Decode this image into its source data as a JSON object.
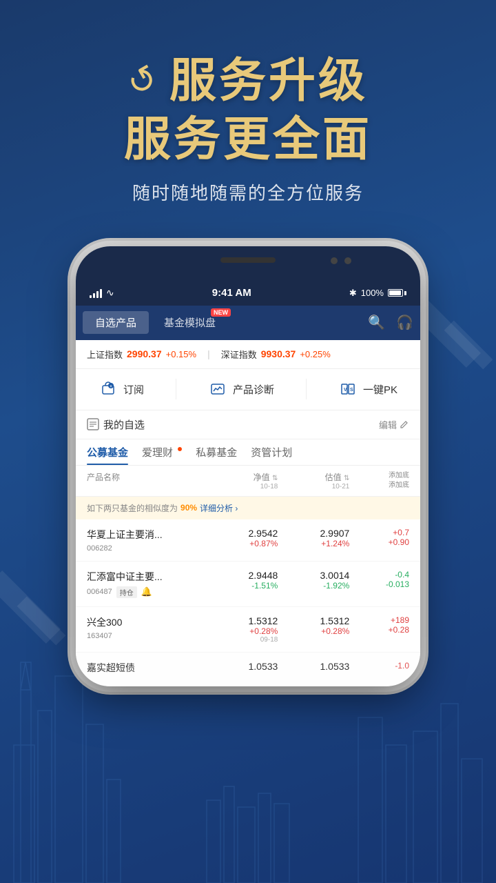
{
  "hero": {
    "title_line1": "服务升级",
    "title_line2": "服务更全面",
    "desc": "随时随地随需的全方位服务",
    "icon_unicode": "↺"
  },
  "phone": {
    "status_bar": {
      "signal": "|||",
      "wifi": "WiFi",
      "time": "9:41 AM",
      "bluetooth": "✱",
      "battery_pct": "100%"
    },
    "nav": {
      "tab1": "自选产品",
      "tab2": "基金模拟盘",
      "tab2_badge": "NEW"
    },
    "index_bar": {
      "sh_name": "上证指数",
      "sh_val": "2990.37",
      "sh_chg": "+0.15%",
      "sz_name": "深证指数",
      "sz_val": "9930.37",
      "sz_chg": "+0.25%"
    },
    "quick_actions": {
      "action1": "订阅",
      "action2": "产品诊断",
      "action3": "一键PK"
    },
    "watchlist": {
      "title": "我的自选",
      "edit": "编辑"
    },
    "fund_tabs": {
      "tab1": "公募基金",
      "tab2": "爱理财",
      "tab3": "私募基金",
      "tab4": "资管计划",
      "tab2_has_dot": true
    },
    "table_headers": {
      "name": "产品名称",
      "nav": "净值",
      "nav_date": "10-18",
      "est": "估值",
      "est_date": "10-21",
      "add": "添加底\n添加底"
    },
    "similarity_warning": {
      "text_before": "如下两只基金的相似度为",
      "pct": "90%",
      "link": "详细分析 ›"
    },
    "funds": [
      {
        "name": "华夏上证主要消...",
        "code": "006282",
        "tag": "",
        "has_bell": false,
        "nav": "2.9542",
        "nav_chg": "+0.87%",
        "nav_up": true,
        "est": "2.9907",
        "est_chg": "+1.24%",
        "est_up": true,
        "action": "+0.7\n+0.90"
      },
      {
        "name": "汇添富中证主要...",
        "code": "006487",
        "tag": "持仓",
        "has_bell": true,
        "nav": "2.9448",
        "nav_chg": "-1.51%",
        "nav_up": false,
        "est": "3.0014",
        "est_chg": "-1.92%",
        "est_up": false,
        "action": "-0.4\n-0.013"
      },
      {
        "name": "兴全300",
        "code": "163407",
        "tag": "",
        "has_bell": false,
        "nav": "1.5312",
        "nav_chg": "+0.28%",
        "nav_up": true,
        "est": "1.5312",
        "est_chg": "+0.28%",
        "est_up": true,
        "action": "+189\n+0.28",
        "date": "09-18"
      },
      {
        "name": "嘉实超短债",
        "code": "",
        "tag": "",
        "has_bell": false,
        "nav": "1.0533",
        "nav_chg": "",
        "nav_up": true,
        "est": "1.0533",
        "est_chg": "",
        "est_up": true,
        "action": "-1.0"
      }
    ]
  }
}
